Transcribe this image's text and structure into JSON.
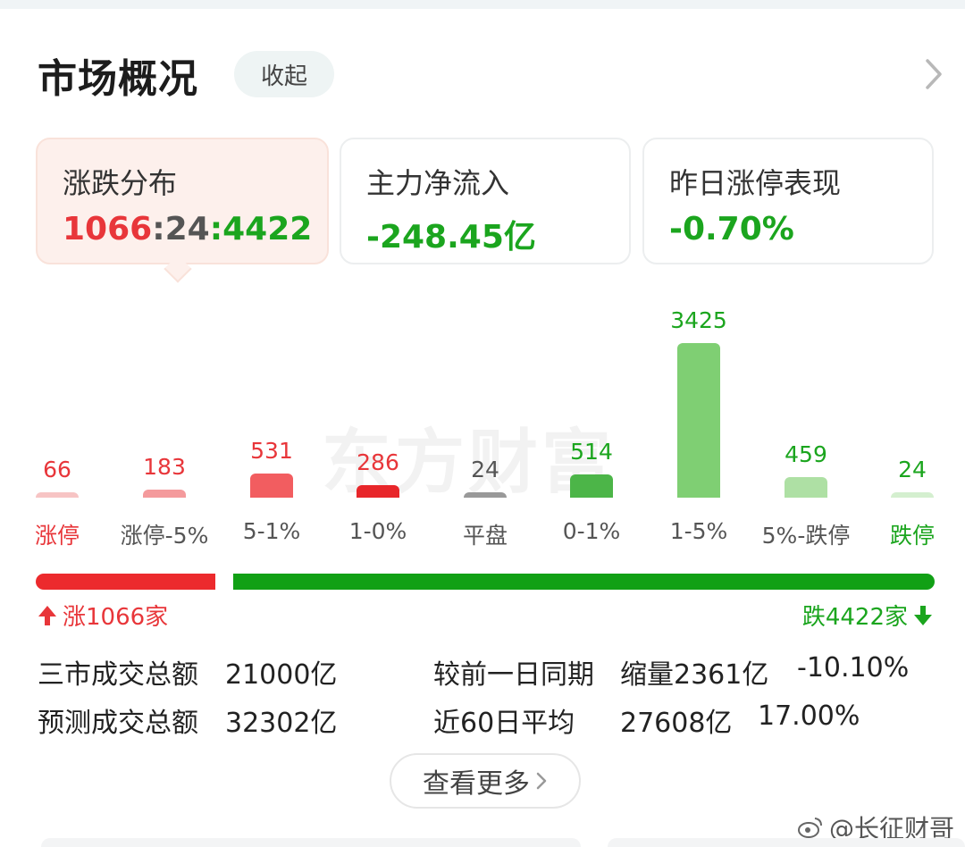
{
  "header": {
    "title": "市场概况",
    "collapse_label": "收起"
  },
  "cards": [
    {
      "label": "涨跌分布",
      "up": "1066",
      "sep1": ":",
      "flat": "24",
      "sep2": ":",
      "down": "4422"
    },
    {
      "label": "主力净流入",
      "value": "-248.45亿"
    },
    {
      "label": "昨日涨停表现",
      "value": "-0.70%"
    }
  ],
  "watermark": "东方财富",
  "chart_data": {
    "type": "bar",
    "categories": [
      "涨停",
      "涨停-5%",
      "5-1%",
      "1-0%",
      "平盘",
      "0-1%",
      "1-5%",
      "5%-跌停",
      "跌停"
    ],
    "values": [
      66,
      183,
      531,
      286,
      24,
      514,
      3425,
      459,
      24
    ],
    "colors": [
      "#f7c4c4",
      "#f49a9c",
      "#f25d60",
      "#e8262a",
      "#999999",
      "#4cb548",
      "#7fcf73",
      "#aee0a4",
      "#d4efcf"
    ],
    "label_colors": [
      "#e8363a",
      "#e8363a",
      "#e8363a",
      "#e8363a",
      "#555555",
      "#1ba51e",
      "#1ba51e",
      "#1ba51e",
      "#1ba51e"
    ],
    "category_colors": [
      "#e8363a",
      "#555555",
      "#555555",
      "#555555",
      "#555555",
      "#555555",
      "#555555",
      "#555555",
      "#1ba51e"
    ]
  },
  "ratio": {
    "up_label": "涨1066家",
    "down_label": "跌4422家",
    "up_value": 1066,
    "down_value": 4422
  },
  "stats": {
    "total_label": "三市成交总额",
    "total_value": "21000亿",
    "compare_label": "较前一日同期",
    "compare_value": "缩量2361亿",
    "compare_pct": "-10.10%",
    "forecast_label": "预测成交总额",
    "forecast_value": "32302亿",
    "avg_label": "近60日平均",
    "avg_value": "27608亿",
    "avg_pct": "17.00%"
  },
  "view_more_label": "查看更多",
  "weibo_handle": "@长征财哥",
  "colors": {
    "red": "#e8363a",
    "green": "#1ba51e",
    "accent_bg": "#fdf0ec"
  }
}
